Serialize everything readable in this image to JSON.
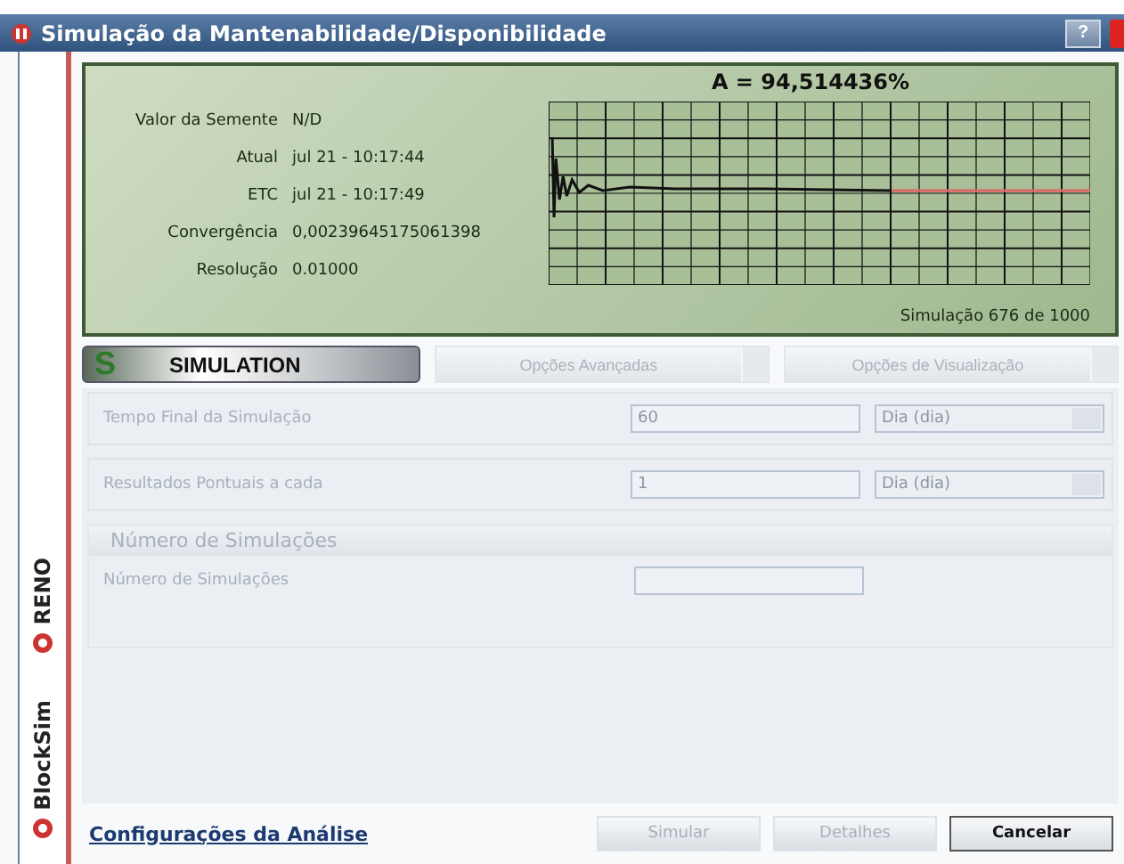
{
  "window": {
    "title": "Simulação da Mantenabilidade/Disponibilidade",
    "help": "?"
  },
  "brand": [
    "RENO",
    "BlockSim"
  ],
  "status": {
    "headline": "A = 94,514436%",
    "rows": [
      {
        "label": "Valor da Semente",
        "value": "N/D"
      },
      {
        "label": "Atual",
        "value": "jul 21 - 10:17:44"
      },
      {
        "label": "ETC",
        "value": "jul 21 - 10:17:49"
      },
      {
        "label": "Convergência",
        "value": "0,00239645175061398"
      },
      {
        "label": "Resolução",
        "value": "0.01000"
      }
    ],
    "progress": "Simulação 676 de 1000"
  },
  "tabs": [
    {
      "kind": "logo",
      "badge": "S",
      "label": "SIMULATION",
      "selected": true
    },
    {
      "kind": "plain",
      "label": "Opções Avançadas",
      "selected": false
    },
    {
      "kind": "plain",
      "label": "Opções de Visualização",
      "selected": false
    }
  ],
  "form": {
    "rows": [
      {
        "label": "Tempo Final da Simulação",
        "value": "60",
        "unit": "Dia (dia)",
        "disabled": true
      },
      {
        "label": "Resultados Pontuais a cada",
        "value": "1",
        "unit": "Dia (dia)",
        "disabled": true
      }
    ],
    "section": {
      "title": "Número de Simulações",
      "rows": [
        {
          "label": "Número de Simulações",
          "disabled": true
        }
      ]
    }
  },
  "footer": {
    "link": "Configurações da Análise",
    "buttons": [
      {
        "label": "Simular",
        "disabled": true
      },
      {
        "label": "Detalhes",
        "disabled": true
      },
      {
        "label": "Cancelar",
        "disabled": false
      }
    ]
  }
}
